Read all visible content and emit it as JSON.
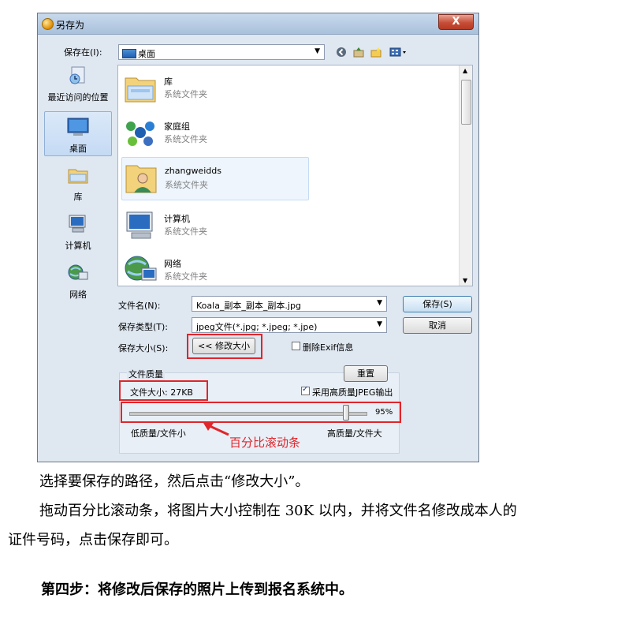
{
  "dialog": {
    "title": "另存为",
    "close": "X",
    "save_in_label": "保存在(I):",
    "save_in_value": "桌面"
  },
  "toolbar": {
    "icons": [
      "back-icon",
      "up-folder-icon",
      "new-folder-icon",
      "view-menu-icon"
    ]
  },
  "nav": [
    {
      "label": "最近访问的位置",
      "icon": "recent-places-icon"
    },
    {
      "label": "桌面",
      "icon": "desktop-icon",
      "selected": true
    },
    {
      "label": "库",
      "icon": "library-icon"
    },
    {
      "label": "计算机",
      "icon": "computer-icon"
    },
    {
      "label": "网络",
      "icon": "network-icon"
    }
  ],
  "files": [
    {
      "name": "库",
      "type": "系统文件夹",
      "icon": "library-folder-icon"
    },
    {
      "name": "家庭组",
      "type": "系统文件夹",
      "icon": "homegroup-icon"
    },
    {
      "name": "zhangweidds",
      "type": "系统文件夹",
      "icon": "user-folder-icon",
      "selected": true
    },
    {
      "name": "计算机",
      "type": "系统文件夹",
      "icon": "computer-icon"
    },
    {
      "name": "网络",
      "type": "系统文件夹",
      "icon": "network-icon"
    }
  ],
  "form": {
    "filename_label": "文件名(N):",
    "filename_value": "Koala_副本_副本_副本.jpg",
    "filetype_label": "保存类型(T):",
    "filetype_value": "jpeg文件(*.jpg; *.jpeg; *.jpe)",
    "save_size_label": "保存大小(S):",
    "resize_button": "<< 修改大小",
    "remove_exif": "删除Exif信息",
    "save_button": "保存(S)",
    "cancel_button": "取消"
  },
  "quality": {
    "group_label": "文件质量",
    "reset_button": "重置",
    "filesize_label": "文件大小: 27KB",
    "high_quality_jpeg": "采用高质量JPEG输出",
    "percent_text": "95%",
    "percent_value": 95,
    "low_label": "低质量/文件小",
    "high_label": "高质量/文件大"
  },
  "annotation": {
    "slider_callout": "百分比滚动条",
    "color": "#e0252b"
  },
  "body": {
    "line1": "选择要保存的路径，然后点击“修改大小”。",
    "line2": "拖动百分比滚动条，将图片大小控制在 30K 以内，并将文件名修改成本人的",
    "line3": "证件号码，点击保存即可。",
    "step4": "第四步：将修改后保存的照片上传到报名系统中。"
  }
}
